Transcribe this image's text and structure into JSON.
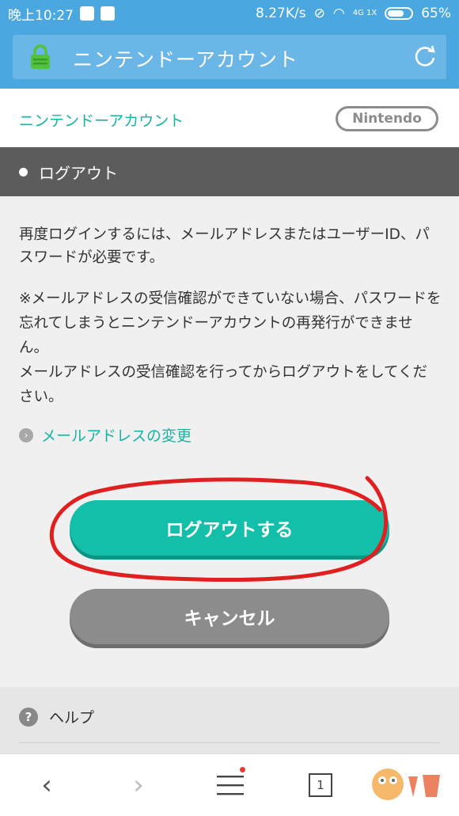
{
  "status_bar": {
    "time": "晚上10:27",
    "speed": "8.27K/s",
    "signal": "4G 1X",
    "battery": "65%"
  },
  "browser": {
    "title": "ニンテンドーアカウント",
    "lock_icon": "lock-icon",
    "reload_icon": "reload-icon"
  },
  "header": {
    "brand": "ニンテンドーアカウント",
    "logo": "Nintendo"
  },
  "section": {
    "title": "ログアウト"
  },
  "content": {
    "paragraph1": "再度ログインするには、メールアドレスまたはユーザーID、パスワードが必要です。",
    "paragraph2_line1": "※メールアドレスの受信確認ができていない場合、パスワードを忘れてしまうとニンテンドーアカウントの再発行ができません。",
    "paragraph2_line2": "メールアドレスの受信確認を行ってからログアウトをしてください。",
    "change_email_link": "メールアドレスの変更",
    "logout_button": "ログアウトする",
    "cancel_button": "キャンセル"
  },
  "help": {
    "label": "ヘルプ"
  },
  "bottom_nav": {
    "back": "‹",
    "forward": "›",
    "tab_count": "1"
  },
  "colors": {
    "accent": "#13bfa9",
    "topbar": "#4aa7e0",
    "section_bar": "#5c5c5c",
    "annotation": "#e02020"
  }
}
